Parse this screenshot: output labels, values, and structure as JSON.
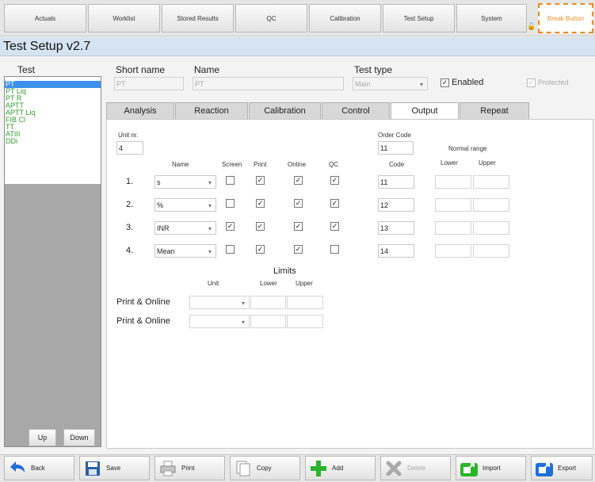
{
  "top_tabs": [
    "Actuals",
    "Worklist",
    "Stored Results",
    "QC",
    "Calibration",
    "Test Setup",
    "System"
  ],
  "break_button": "Break Button",
  "title": "Test Setup v2.7",
  "left": {
    "header": "Test",
    "tests": [
      "PT",
      "PT Liq",
      "PT R",
      "APTT",
      "APTT Liq",
      "FIB Cl",
      "TT",
      "ATIII",
      "DDi"
    ],
    "up": "Up",
    "down": "Down"
  },
  "header": {
    "short_name_label": "Short name",
    "short_name_value": "PT",
    "name_label": "Name",
    "name_value": "PT",
    "test_type_label": "Test type",
    "test_type_value": "Main",
    "enabled_label": "Enabled",
    "protected_label": "Protected"
  },
  "subtabs": [
    "Analysis",
    "Reaction",
    "Calibration",
    "Control",
    "Output",
    "Repeat"
  ],
  "output": {
    "unit_nr_label": "Unit nr.",
    "unit_nr_value": "4",
    "order_code_label": "Order Code",
    "order_code_value": "11",
    "normal_range_label": "Normal range",
    "col_name": "Name",
    "col_screen": "Screen",
    "col_print": "Print",
    "col_online": "Online",
    "col_qc": "QC",
    "col_code": "Code",
    "col_lower": "Lower",
    "col_upper": "Upper",
    "rows": [
      {
        "num": "1.",
        "name": "s",
        "screen": false,
        "print": true,
        "online": true,
        "qc": true,
        "code": "11"
      },
      {
        "num": "2.",
        "name": "%",
        "screen": false,
        "print": true,
        "online": true,
        "qc": true,
        "code": "12"
      },
      {
        "num": "3.",
        "name": "INR",
        "screen": true,
        "print": true,
        "online": true,
        "qc": true,
        "code": "13"
      },
      {
        "num": "4.",
        "name": "Mean",
        "screen": false,
        "print": true,
        "online": true,
        "qc": false,
        "code": "14"
      }
    ],
    "limits_label": "Limits",
    "limits_unit": "Unit",
    "limits_lower": "Lower",
    "limits_upper": "Upper",
    "limit_rows": [
      "Print & Online",
      "Print & Online"
    ]
  },
  "toolbar": [
    "Back",
    "Save",
    "Print",
    "Copy",
    "Add",
    "Delete",
    "Import",
    "Export"
  ],
  "colors": {
    "accent": "#3d8ff0",
    "list_text": "#2da12d",
    "break": "#f08a1d",
    "add": "#2bb52b"
  }
}
